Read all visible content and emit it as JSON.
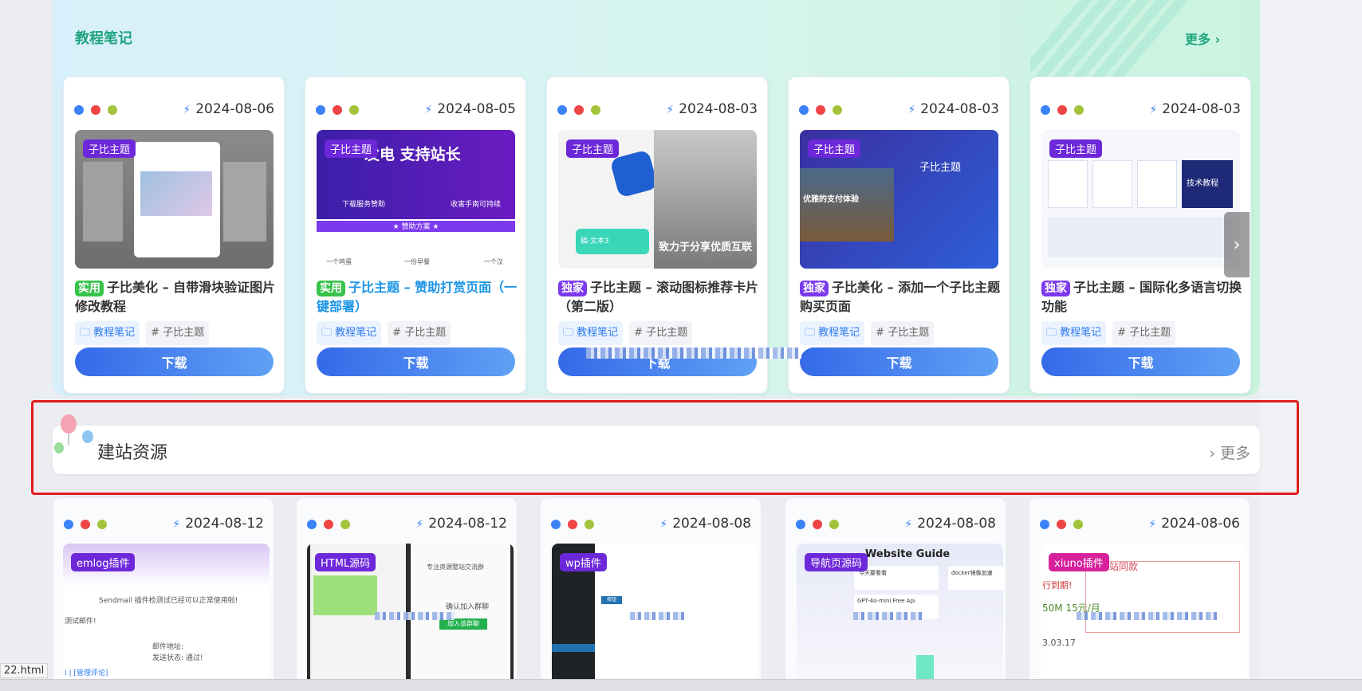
{
  "section1": {
    "title": "教程笔记",
    "more_label": "更多 ›",
    "cards": [
      {
        "date": "2024-08-06",
        "thumb_tag": "子比主题",
        "badge": "实用",
        "title": "子比美化 – 自带滑块验证图片修改教程",
        "category": "教程笔记",
        "tag": "# 子比主题",
        "download": "下载"
      },
      {
        "date": "2024-08-05",
        "thumb_tag": "子比主题",
        "badge": "实用",
        "title": "子比主题 – 赞助打赏页面（一键部署）",
        "category": "教程笔记",
        "tag": "# 子比主题",
        "download": "下载",
        "thumb_text": "发电 支持站长",
        "thumb_sub1": "下载服务赞助",
        "thumb_sub2": "收害手南可持续",
        "thumb_banner": "★ 赞助方案 ★",
        "thumb_c1": "一个鸡蛋",
        "thumb_c2": "一份早餐",
        "thumb_c3": "一个汉"
      },
      {
        "date": "2024-08-03",
        "thumb_tag": "子比主题",
        "badge": "独家",
        "title": "子比主题 – 滚动图标推荐卡片（第二版）",
        "category": "教程笔记",
        "tag": "# 子比主题",
        "download": "下载",
        "thumb_text": "致力于分享优质互联",
        "thumb_small": "稿·文本3"
      },
      {
        "date": "2024-08-03",
        "thumb_tag": "子比主题",
        "badge": "独家",
        "title": "子比美化 – 添加一个子比主题购买页面",
        "category": "教程笔记",
        "tag": "# 子比主题",
        "download": "下载",
        "thumb_text": "子比主题",
        "thumb_sub": "优雅的支付体验"
      },
      {
        "date": "2024-08-03",
        "thumb_tag": "子比主题",
        "badge": "独家",
        "title": "子比主题 – 国际化多语言切换功能",
        "category": "教程笔记",
        "tag": "# 子比主题",
        "download": "下载",
        "thumb_small": "技术教程"
      }
    ]
  },
  "section2": {
    "title": "建站资源",
    "more_label": "› 更多",
    "cards": [
      {
        "date": "2024-08-12",
        "thumb_tag": "emlog插件",
        "tag_color": "#6d28d9",
        "line1": "Sendmail 插件检测试已经可以正常使用啦!",
        "line2": "邮件地址:",
        "line3": "发送状态: 通过!",
        "line4": "测试邮件!",
        "line5": "I | [管理评论]"
      },
      {
        "date": "2024-08-12",
        "thumb_tag": "HTML源码",
        "tag_color": "#6d28d9",
        "line1": "专注资源整站交流群",
        "line2": "确认加入群聊",
        "line3": "加入该群聊"
      },
      {
        "date": "2024-08-08",
        "thumb_tag": "wp插件",
        "tag_color": "#6d28d9",
        "line1": "按钮"
      },
      {
        "date": "2024-08-08",
        "thumb_tag": "导航页源码",
        "tag_color": "#6d28d9",
        "heading": "Website Guide",
        "line1": "今天要看看",
        "line2": "GPT-4o-mini Free Api",
        "line3": "docker镜像加速"
      },
      {
        "date": "2024-08-06",
        "thumb_tag": "xiuno插件",
        "tag_color": "#d6219b",
        "line1": "本站同款",
        "line2": "行到期!",
        "line3": "50M 15元/月",
        "line4": "3.03.17"
      }
    ]
  },
  "file_tip": "22.html"
}
